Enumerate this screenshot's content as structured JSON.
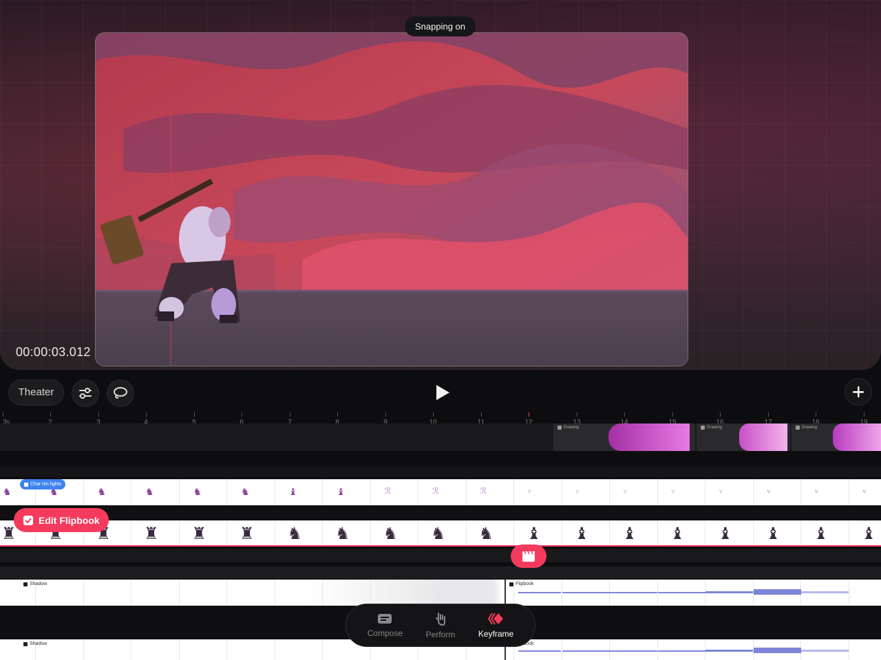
{
  "stage": {
    "snapping_label": "Snapping on",
    "timecode": "00:00:03.012"
  },
  "controls": {
    "theater_label": "Theater",
    "settings_icon": "sliders-icon",
    "lasso_icon": "lasso-icon",
    "play_icon": "play-icon",
    "add_icon": "plus-icon"
  },
  "ruler": {
    "start_label": "3s",
    "ticks": [
      "2",
      "3",
      "4",
      "5",
      "6",
      "7",
      "8",
      "9",
      "10",
      "11",
      "12",
      "13",
      "14",
      "15",
      "16",
      "17",
      "18",
      "19"
    ]
  },
  "tracks": {
    "drawing_clips": [
      "Drawing",
      "Drawing",
      "Drawing"
    ],
    "char_rim_label": "Char rim lights",
    "edit_flipbook_label": "Edit Flipbook",
    "shadow_label_1": "Shadow",
    "flipbook_label_1": "Flipbook",
    "shadow_label_2": "Shadow",
    "flipbook_label_2": "Flipbook"
  },
  "modes": [
    {
      "label": "Compose",
      "icon": "compose-icon",
      "active": false
    },
    {
      "label": "Perform",
      "icon": "hand-icon",
      "active": false
    },
    {
      "label": "Keyframe",
      "icon": "keyframe-icon",
      "active": true
    }
  ],
  "colors": {
    "accent": "#f43b5e",
    "blue_tag": "#3f83f0",
    "stroke_blue": "#7d84d8"
  }
}
